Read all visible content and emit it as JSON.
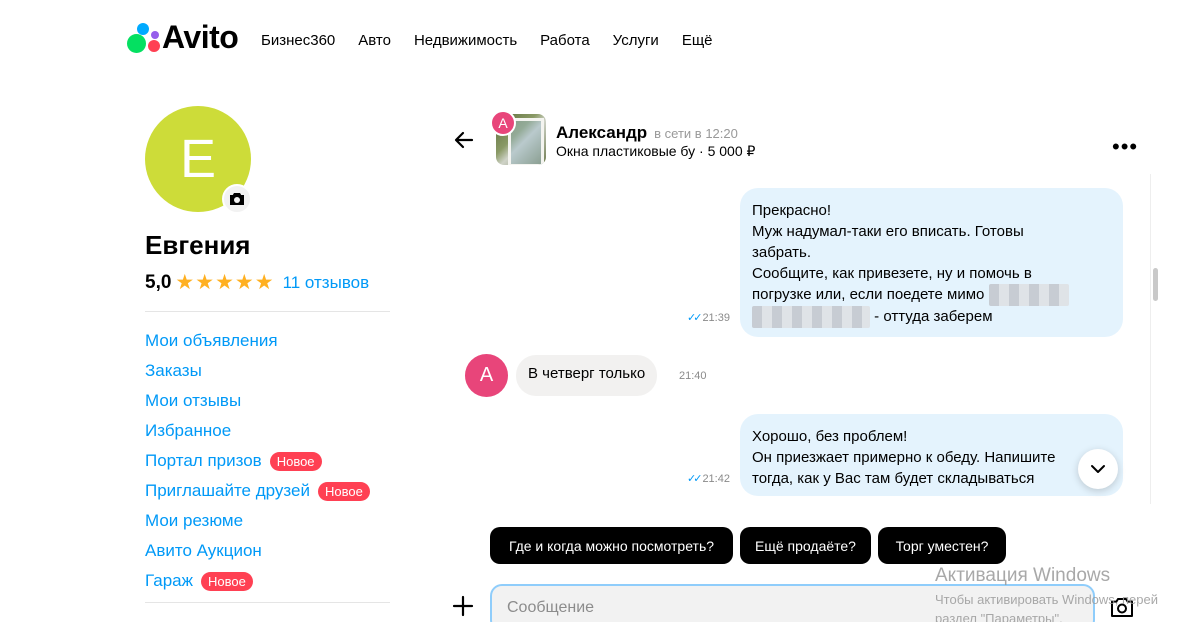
{
  "header": {
    "logo_text": "Avito",
    "nav": [
      "Бизнес360",
      "Авто",
      "Недвижимость",
      "Работа",
      "Услуги",
      "Ещё"
    ]
  },
  "profile": {
    "avatar_letter": "Е",
    "name": "Евгения",
    "rating": "5,0",
    "stars": 5,
    "stars_display": "★★★★★",
    "reviews": "11 отзывов",
    "avatar_color": "#cddc39"
  },
  "menu": [
    {
      "label": "Мои объявления",
      "badge": ""
    },
    {
      "label": "Заказы",
      "badge": ""
    },
    {
      "label": "Мои отзывы",
      "badge": ""
    },
    {
      "label": "Избранное",
      "badge": ""
    },
    {
      "label": "Портал призов",
      "badge": "Новое"
    },
    {
      "label": "Приглашайте друзей",
      "badge": "Новое"
    },
    {
      "label": "Мои резюме",
      "badge": ""
    },
    {
      "label": "Авито Аукцион",
      "badge": ""
    },
    {
      "label": "Гараж",
      "badge": "Новое"
    }
  ],
  "chat": {
    "contact_letter": "А",
    "contact_name": "Александр",
    "contact_status": "в сети в 12:20",
    "item_line": "Окна пластиковые бу · 5 000 ₽",
    "messages": [
      {
        "direction": "out",
        "lines": [
          "Прекрасно!",
          "Муж надумал-таки его вписать. Готовы",
          "забрать.",
          "Сообщите, как привезете, ну и помочь в",
          "погрузке или, если поедете мимо",
          "- оттуда заберем"
        ],
        "time": "21:39"
      },
      {
        "direction": "in",
        "lines": [
          "В четверг только"
        ],
        "time": "21:40"
      },
      {
        "direction": "out",
        "lines": [
          "Хорошо, без проблем!",
          "Он приезжает примерно к обеду. Напишите",
          "тогда, как у Вас там будет складываться"
        ],
        "time": "21:42"
      }
    ]
  },
  "quick_replies": [
    "Где и когда можно посмотреть?",
    "Ещё продаёте?",
    "Торг уместен?"
  ],
  "composer": {
    "placeholder": "Сообщение",
    "value": ""
  },
  "watermark": {
    "title": "Активация Windows",
    "line1": "Чтобы активировать Windows, перей",
    "line2": "раздел \"Параметры\"."
  },
  "colors": {
    "accent_link": "#0099f7",
    "badge_new": "#ff4053",
    "outgoing_bubble": "#e4f3fd",
    "incoming_bubble": "#f2f1f0",
    "contact_avatar": "#e8457a",
    "star": "#ffb021"
  }
}
